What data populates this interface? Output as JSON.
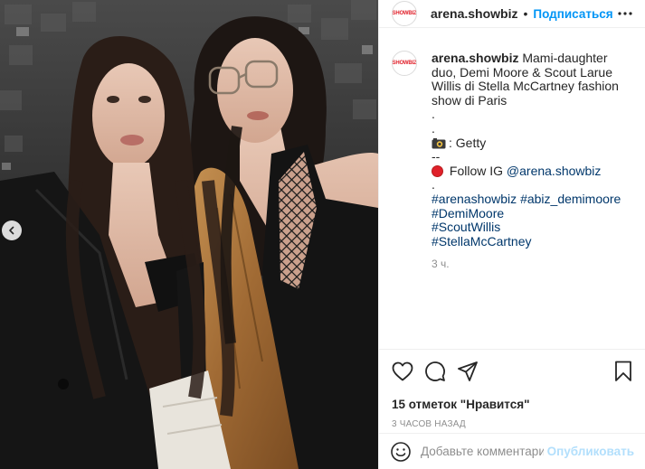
{
  "header": {
    "avatar_text": "SHOWBIZ",
    "username": "arena.showbiz",
    "separator": "•",
    "follow_label": "Подписаться"
  },
  "caption": {
    "username": "arena.showbiz",
    "text": " Mami-daughter duo, Demi Moore & Scout Larue Willis di Stella McCartney fashion show di Paris",
    "dot1": ".",
    "dot2": ".",
    "credit": ": Getty",
    "dashes": "--",
    "follow_prefix": " Follow IG ",
    "follow_handle": "@arena.showbiz",
    "dot3": ".",
    "hashtags": [
      "#arenashowbiz",
      "#abiz_demimoore",
      "#DemiMoore",
      "#ScoutWillis",
      "#StellaMcCartney"
    ],
    "time": "3 ч."
  },
  "likes": "15 отметок \"Нравится\"",
  "date": "3 ЧАСОВ НАЗАД",
  "comment_box": {
    "placeholder": "Добавьте комментарий...",
    "publish_label": "Опубликовать"
  },
  "colors": {
    "link": "#0095f6",
    "hashtag": "#00376b",
    "muted": "#8e8e8e"
  },
  "icons": [
    "chevron-left-icon",
    "more-icon",
    "camera-icon",
    "red-circle-icon",
    "heart-icon",
    "comment-icon",
    "share-icon",
    "bookmark-icon",
    "emoji-icon"
  ]
}
